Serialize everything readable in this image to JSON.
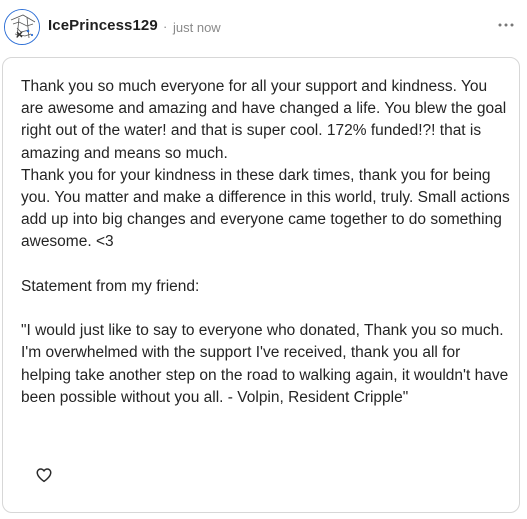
{
  "post": {
    "author": "IcePrincess129",
    "separator": "·",
    "timestamp": "just now",
    "paragraphs": [
      "Thank you so much everyone for all your support and kindness. You are awesome and amazing and have changed a life. You blew the goal right out of the water! and that is super cool. 172% funded!?! that is amazing and means so much.",
      "Thank you for your kindness in these dark times, thank you for being you. You matter and make a difference in this world, truly. Small actions add up into big changes and everyone came together to do something awesome. <3",
      "",
      "Statement from my friend:",
      "",
      "\"I would just like to say to everyone who donated, Thank you so much. I'm overwhelmed with the support I've received, thank you all for helping take another step on the road to walking again, it wouldn't have been possible without you all. - Volpin, Resident Cripple\""
    ]
  },
  "icons": {
    "avatar": "avatar",
    "more": "more-options-icon",
    "like": "heart-icon"
  },
  "colors": {
    "avatar_border": "#2d6fd6",
    "card_border": "#d7d7d7",
    "meta_text": "#8a8a8a"
  }
}
